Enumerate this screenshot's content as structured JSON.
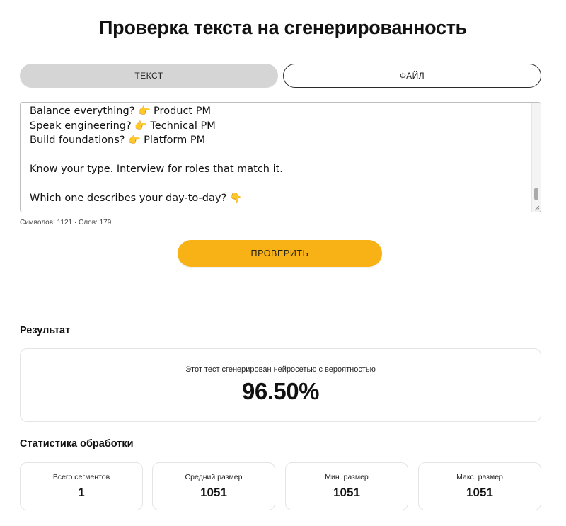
{
  "page": {
    "title": "Проверка текста на сгенерированность"
  },
  "tabs": [
    {
      "label": "ТЕКСТ",
      "active": true
    },
    {
      "label": "ФАЙЛ",
      "active": false
    }
  ],
  "input": {
    "lines": [
      {
        "text": "Balance everything? ",
        "emoji": "👉",
        "after": " Product PM"
      },
      {
        "text": "Speak engineering? ",
        "emoji": "👉",
        "after": " Technical PM"
      },
      {
        "text": "Build foundations? ",
        "emoji": "👉",
        "after": " Platform PM"
      },
      {
        "text": "",
        "emoji": "",
        "after": ""
      },
      {
        "text": "Know your type. Interview for roles that match it.",
        "emoji": "",
        "after": ""
      },
      {
        "text": "",
        "emoji": "",
        "after": ""
      },
      {
        "text": "Which one describes your day-to-day? ",
        "emoji": "👇",
        "after": ""
      }
    ],
    "counters": "Символов: 1121 · Слов: 179"
  },
  "check_button": {
    "label": "ПРОВЕРИТЬ"
  },
  "result": {
    "heading": "Результат",
    "caption": "Этот тест сгенерирован нейросетью с вероятностью",
    "value": "96.50%"
  },
  "stats": {
    "heading": "Статистика обработки",
    "items": [
      {
        "label": "Всего сегментов",
        "value": "1"
      },
      {
        "label": "Средний размер",
        "value": "1051"
      },
      {
        "label": "Мин. размер",
        "value": "1051"
      },
      {
        "label": "Макс. размер",
        "value": "1051"
      }
    ]
  },
  "colors": {
    "accent": "#f8b215",
    "active_tab": "#d5d5d5",
    "border": "#e4e4e4"
  },
  "scrollbar": {
    "position_fraction": 0.9
  }
}
